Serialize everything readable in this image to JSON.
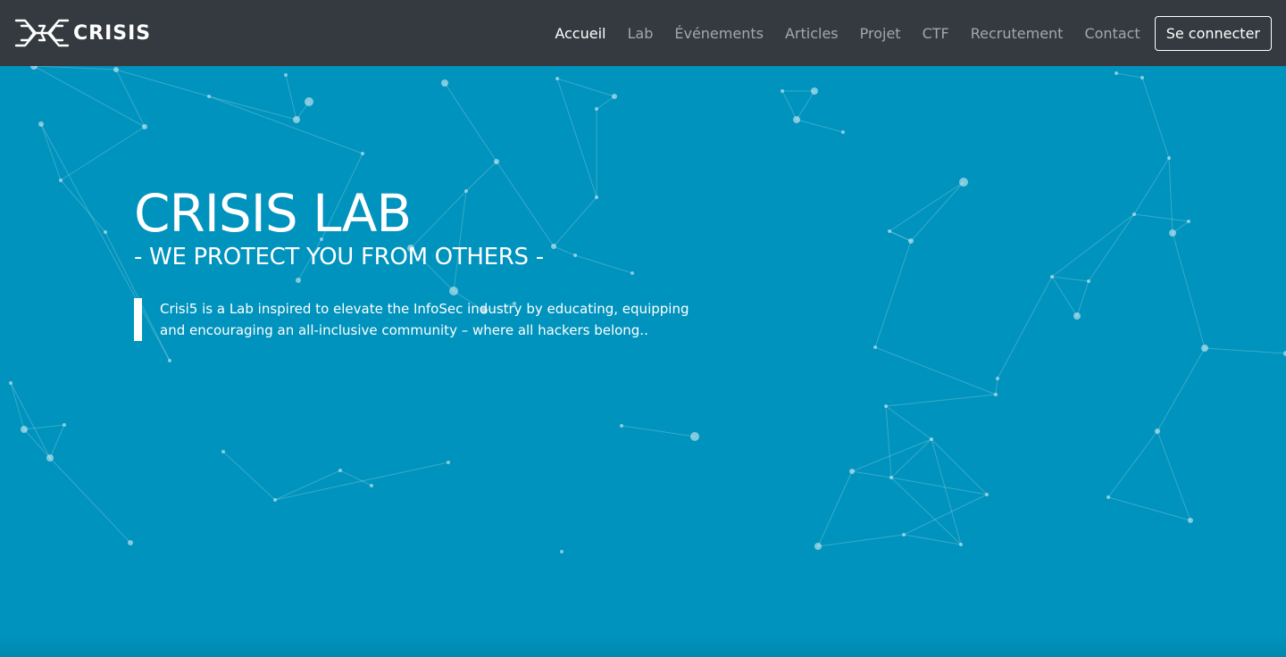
{
  "brand": {
    "name": "CRISIS",
    "logo_icon": "crisis-logo-icon"
  },
  "nav": {
    "items": [
      {
        "label": "Accueil",
        "active": true
      },
      {
        "label": "Lab",
        "active": false
      },
      {
        "label": "Événements",
        "active": false
      },
      {
        "label": "Articles",
        "active": false
      },
      {
        "label": "Projet",
        "active": false
      },
      {
        "label": "CTF",
        "active": false
      },
      {
        "label": "Recrutement",
        "active": false
      },
      {
        "label": "Contact",
        "active": false
      }
    ],
    "login_label": "Se connecter"
  },
  "hero": {
    "title": "CRISIS LAB",
    "subtitle": "- WE PROTECT YOU FROM OTHERS -",
    "description": "Crisi5 is a Lab inspired to elevate the InfoSec industry by educating, equipping and encouraging an all-inclusive community – where all hackers belong.."
  },
  "colors": {
    "navbar_bg": "#343a40",
    "hero_bg": "#0093bd",
    "text": "#ffffff",
    "nav_inactive": "#a6a8aa"
  }
}
